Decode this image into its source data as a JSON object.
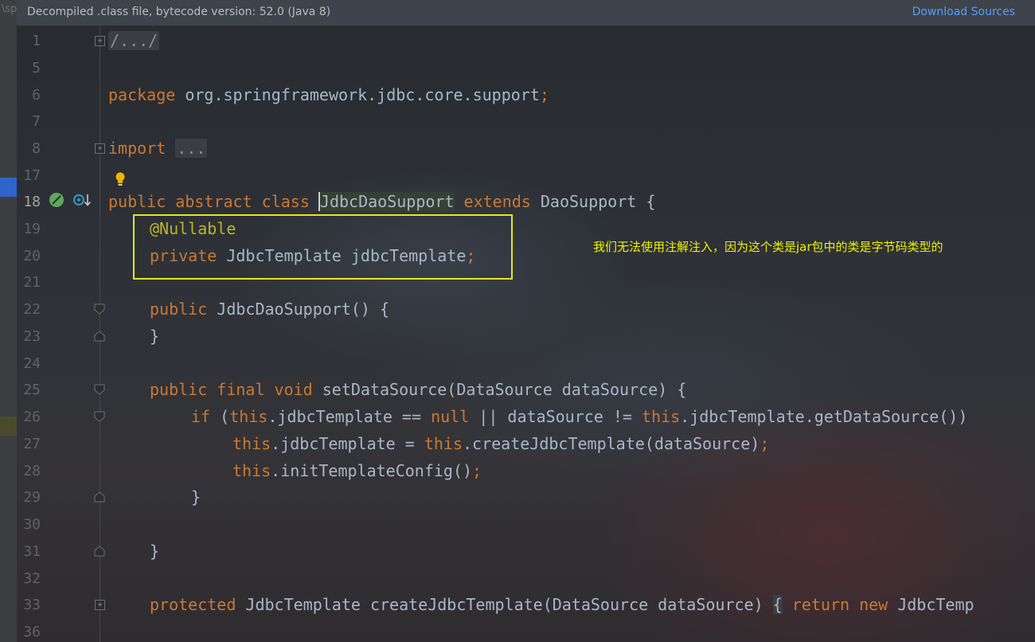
{
  "sidebar": {
    "fragment": "\\sp"
  },
  "banner": {
    "info": "Decompiled .class file, bytecode version: 52.0 (Java 8)",
    "download_sources": "Download Sources"
  },
  "annotation": {
    "note": "我们无法使用注解注入，因为这个类是jar包中的类是字节码类型的",
    "color": "#e6e61c"
  },
  "editor": {
    "lines": [
      {
        "n": "1"
      },
      {
        "n": "5"
      },
      {
        "n": "6"
      },
      {
        "n": "7"
      },
      {
        "n": "8"
      },
      {
        "n": "17"
      },
      {
        "n": "18"
      },
      {
        "n": "19"
      },
      {
        "n": "20"
      },
      {
        "n": "21"
      },
      {
        "n": "22"
      },
      {
        "n": "23"
      },
      {
        "n": "24"
      },
      {
        "n": "25"
      },
      {
        "n": "26"
      },
      {
        "n": "27"
      },
      {
        "n": "28"
      },
      {
        "n": "29"
      },
      {
        "n": "30"
      },
      {
        "n": "31"
      },
      {
        "n": "32"
      },
      {
        "n": "33"
      },
      {
        "n": "36"
      }
    ],
    "code": {
      "l1_folded": "/.../",
      "l6_kw": "package",
      "l6_pkg": " org.springframework.jdbc.core.support",
      "l8_kw": "import",
      "l8_folded": "...",
      "l18_kw": "public abstract class",
      "l18_name": "JdbcDaoSupport",
      "l18_ext": "extends",
      "l18_rest": " DaoSupport {",
      "l19_annot": "@Nullable",
      "l20_kw": "private",
      "l20_rest": " JdbcTemplate jdbcTemplate",
      "l22_kw": "public",
      "l22_rest": " JdbcDaoSupport() {",
      "l23": "}",
      "l25_kw": "public final void",
      "l25_rest": " setDataSource(DataSource dataSource) {",
      "l26_if": "if",
      "l26_a": " (",
      "l26_this1": "this",
      "l26_b": ".jdbcTemplate == ",
      "l26_null": "null",
      "l26_c": " || dataSource != ",
      "l26_this2": "this",
      "l26_d": ".jdbcTemplate.getDataSource())",
      "l27_this1": "this",
      "l27_a": ".jdbcTemplate = ",
      "l27_this2": "this",
      "l27_b": ".createJdbcTemplate(dataSource)",
      "l28_this": "this",
      "l28_rest": ".initTemplateConfig()",
      "l29": "}",
      "l31": "}",
      "l33_kw": "protected",
      "l33_a": " JdbcTemplate createJdbcTemplate(DataSource dataSource) ",
      "l33_brace": "{",
      "l33_return": "return",
      "l33_new": "new",
      "l33_rest": " JdbcTemp",
      "semicolon": ";"
    }
  },
  "icons": [
    "fold-expand-icon",
    "fold-collapse-icon",
    "lightbulb-icon",
    "spring-bean-icon",
    "override-down-icon"
  ]
}
